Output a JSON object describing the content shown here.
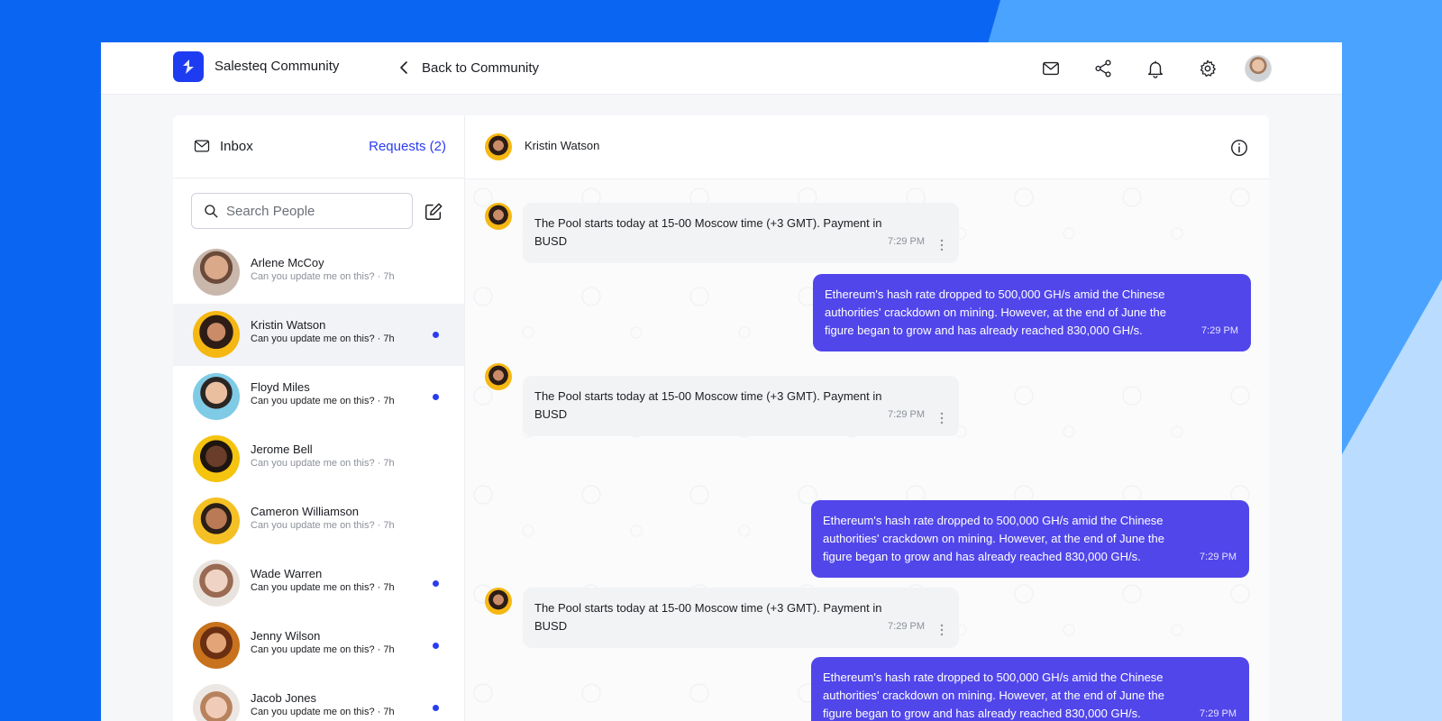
{
  "header": {
    "app_name": "Salesteq Community",
    "back_label": "Back to Community",
    "icons": [
      "mail-icon",
      "share-icon",
      "bell-icon",
      "gear-icon"
    ]
  },
  "inbox": {
    "title": "Inbox",
    "requests_label": "Requests (2)",
    "search_placeholder": "Search People"
  },
  "contacts": [
    {
      "name": "Arlene McCoy",
      "preview": "Can you update me on this? · 7h",
      "unread": false,
      "active": false
    },
    {
      "name": "Kristin Watson",
      "preview": "Can you update me on this? · 7h",
      "unread": true,
      "active": true
    },
    {
      "name": "Floyd Miles",
      "preview": "Can you update me on this? · 7h",
      "unread": true,
      "active": false
    },
    {
      "name": "Jerome Bell",
      "preview": "Can you update me on this? · 7h",
      "unread": false,
      "active": false
    },
    {
      "name": "Cameron Williamson",
      "preview": "Can you update me on this? · 7h",
      "unread": false,
      "active": false
    },
    {
      "name": "Wade Warren",
      "preview": "Can you update me on this? · 7h",
      "unread": true,
      "active": false
    },
    {
      "name": "Jenny Wilson",
      "preview": "Can you update me on this? · 7h",
      "unread": true,
      "active": false
    },
    {
      "name": "Jacob Jones",
      "preview": "Can you update me on this? · 7h",
      "unread": true,
      "active": false
    }
  ],
  "chat": {
    "contact_name": "Kristin Watson",
    "messages": [
      {
        "direction": "in",
        "text": "The Pool starts today at 15-00 Moscow time (+3 GMT). Payment in BUSD",
        "time": "7:29 PM"
      },
      {
        "direction": "out",
        "text": "Ethereum's hash rate dropped to 500,000 GH/s amid the Chinese authorities' crackdown on mining. However, at the end of June the figure began to grow and has already reached 830,000 GH/s.",
        "time": "7:29 PM"
      },
      {
        "direction": "in",
        "text": "The Pool starts today at 15-00 Moscow time (+3 GMT). Payment in BUSD",
        "time": "7:29 PM"
      },
      {
        "direction": "out",
        "text": "Ethereum's hash rate dropped to 500,000 GH/s amid the Chinese authorities' crackdown on mining. However, at the end of June the figure began to grow and has already reached 830,000 GH/s.",
        "time": "7:29 PM"
      },
      {
        "direction": "in",
        "text": "The Pool starts today at 15-00 Moscow time (+3 GMT). Payment in BUSD",
        "time": "7:29 PM"
      },
      {
        "direction": "out",
        "text": "Ethereum's hash rate dropped to 500,000 GH/s amid the Chinese authorities' crackdown on mining. However, at the end of June the figure began to grow and has already reached 830,000 GH/s.",
        "time": "7:29 PM"
      }
    ]
  },
  "colors": {
    "accent": "#2a3cf0",
    "outgoing_bubble": "#5146ea",
    "background": "#0a66f2"
  }
}
